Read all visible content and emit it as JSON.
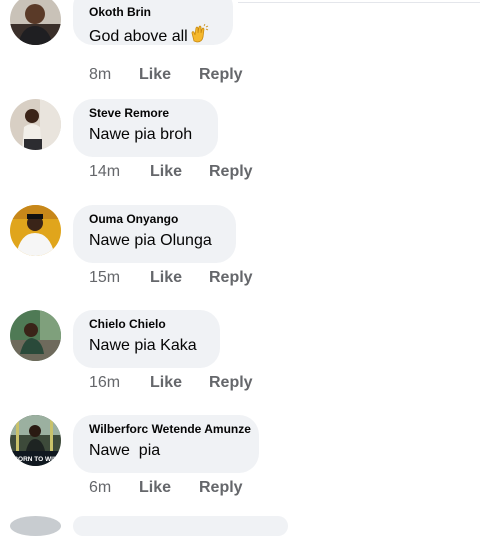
{
  "comments": [
    {
      "author": "Okoth Brin",
      "text": "God above all",
      "emoji": "clapping-hands-icon",
      "time": "8m",
      "like": "Like",
      "reply": "Reply"
    },
    {
      "author": "Steve Remore",
      "text": "Nawe pia broh",
      "time": "14m",
      "like": "Like",
      "reply": "Reply"
    },
    {
      "author": "Ouma Onyango",
      "text": "Nawe pia Olunga",
      "time": "15m",
      "like": "Like",
      "reply": "Reply"
    },
    {
      "author": "Chielo Chielo",
      "text": "Nawe pia Kaka",
      "time": "16m",
      "like": "Like",
      "reply": "Reply"
    },
    {
      "author": "Wilberforc Wetende Amunze",
      "text": "Nawe  pia",
      "time": "6m",
      "like": "Like",
      "reply": "Reply",
      "avatar_caption": "BORN TO WIN"
    }
  ],
  "colors": {
    "bubble": "#f0f2f5",
    "meta_text": "#65676b",
    "body_text": "#050505"
  }
}
